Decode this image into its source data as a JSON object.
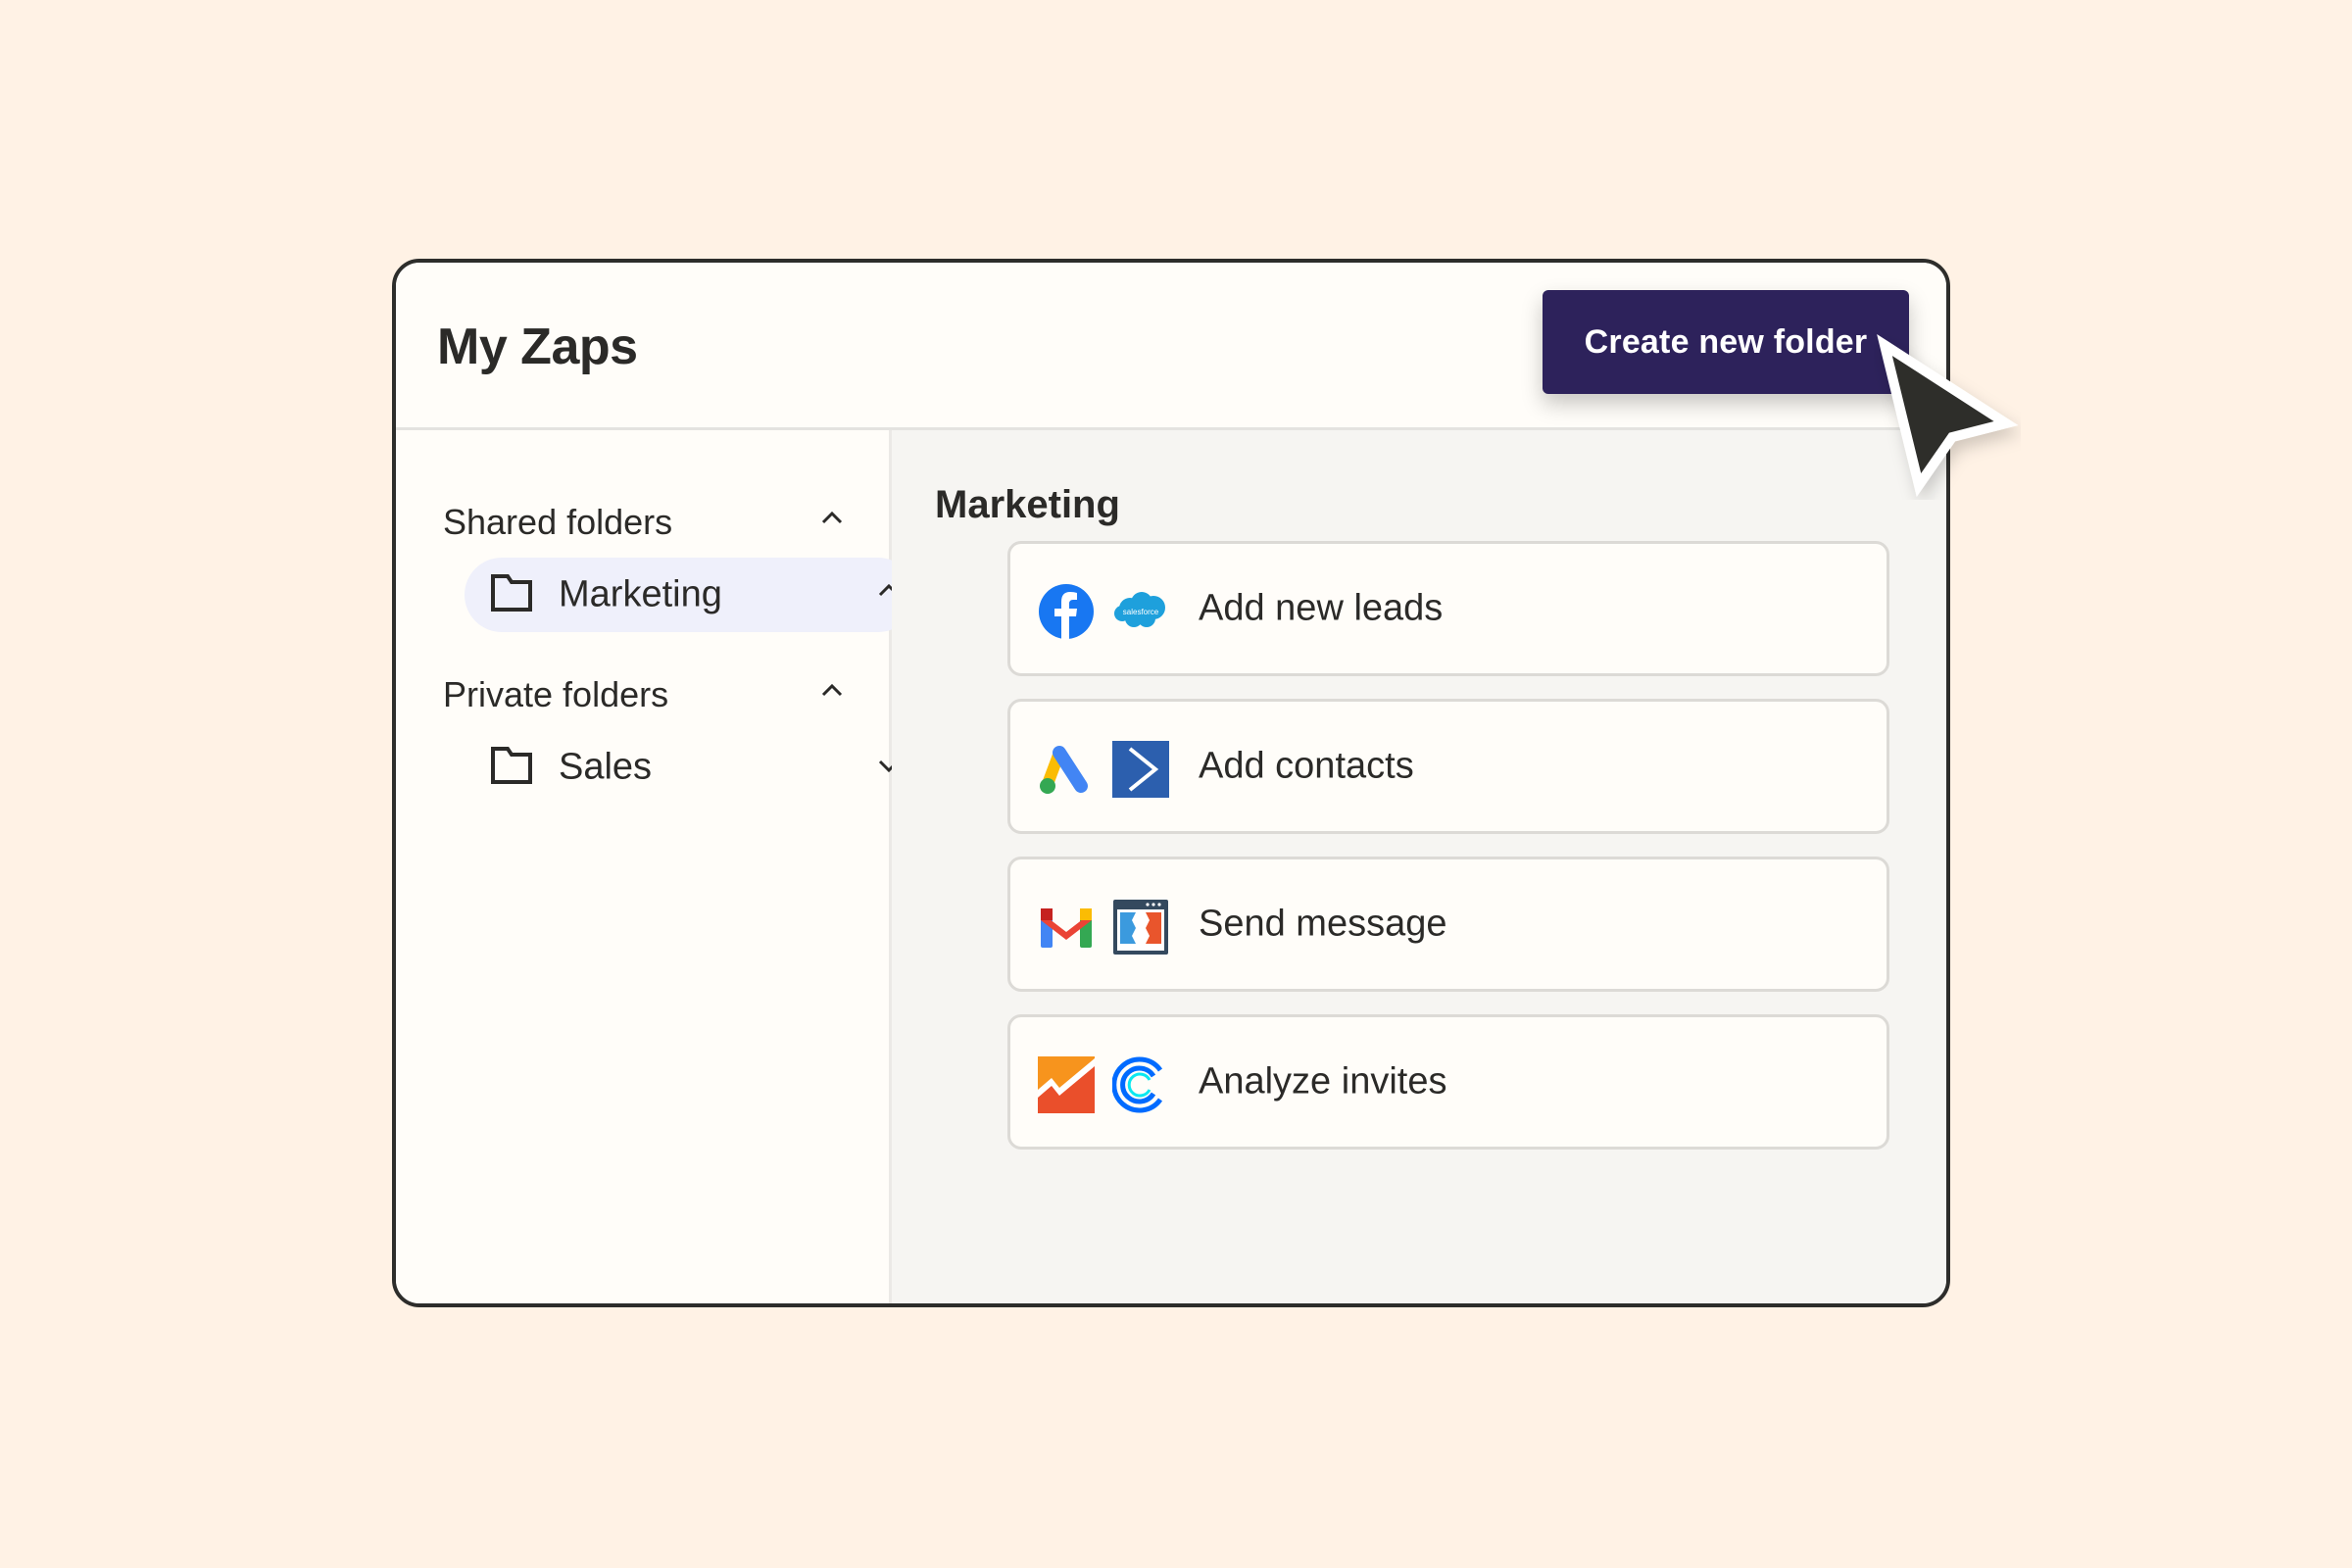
{
  "header": {
    "title": "My Zaps",
    "create_button_label": "Create new folder"
  },
  "colors": {
    "page_background": "#fff2e5",
    "primary_button": "#2d225b",
    "active_item_background": "#eff0fb",
    "text": "#2b2a28"
  },
  "sidebar": {
    "sections": [
      {
        "label": "Shared folders",
        "expanded": true,
        "folders": [
          {
            "label": "Marketing",
            "active": true,
            "expanded": true,
            "icon": "folder-icon"
          }
        ]
      },
      {
        "label": "Private folders",
        "expanded": true,
        "folders": [
          {
            "label": "Sales",
            "active": false,
            "expanded": false,
            "icon": "folder-icon"
          }
        ]
      }
    ]
  },
  "main": {
    "folder_title": "Marketing",
    "members": [
      {
        "name": "member-1",
        "bg": "#f3cad5"
      },
      {
        "name": "member-2",
        "bg": "#3a3a3a"
      },
      {
        "name": "member-3",
        "bg": "#e8c11f"
      }
    ],
    "zaps": [
      {
        "label": "Add new leads",
        "apps": [
          "facebook-icon",
          "salesforce-icon"
        ]
      },
      {
        "label": "Add contacts",
        "apps": [
          "google-ads-icon",
          "activecampaign-icon"
        ]
      },
      {
        "label": "Send message",
        "apps": [
          "gmail-icon",
          "clickfunnels-icon"
        ]
      },
      {
        "label": "Analyze invites",
        "apps": [
          "google-analytics-icon",
          "calendly-icon"
        ]
      }
    ]
  },
  "icons": {
    "salesforce_text": "salesforce"
  }
}
